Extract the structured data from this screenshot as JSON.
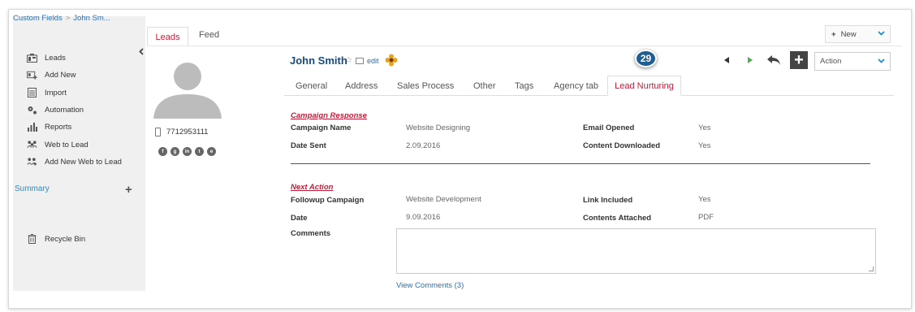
{
  "breadcrumb": {
    "items": [
      "Custom Fields",
      "John Sm..."
    ],
    "separator": ">"
  },
  "sidebar": {
    "items": [
      {
        "label": "Leads",
        "icon": "leads-icon"
      },
      {
        "label": "Add New",
        "icon": "add-new-icon"
      },
      {
        "label": "Import",
        "icon": "import-icon"
      },
      {
        "label": "Automation",
        "icon": "automation-icon"
      },
      {
        "label": "Reports",
        "icon": "reports-icon"
      },
      {
        "label": "Web to Lead",
        "icon": "web-to-lead-icon"
      },
      {
        "label": "Add New Web to Lead",
        "icon": "add-web-to-lead-icon"
      }
    ],
    "summary_label": "Summary",
    "recycle_label": "Recycle Bin"
  },
  "top_tabs": {
    "leads": "Leads",
    "feed": "Feed"
  },
  "new_button": {
    "plus": "+",
    "label": "New"
  },
  "profile": {
    "phone": "7712953111",
    "social_icons": [
      "f",
      "g",
      "in",
      "t",
      "e"
    ]
  },
  "header": {
    "name": "John Smith",
    "star": "☆",
    "edit_label": "edit",
    "badge": "29",
    "action_select": "Action",
    "add_symbol": "+"
  },
  "tabs": [
    "General",
    "Address",
    "Sales Process",
    "Other",
    "Tags",
    "Agency tab"
  ],
  "active_tab": "Lead Nurturing",
  "campaign_response": {
    "title": "Campaign Response",
    "campaign_name_label": "Campaign Name",
    "campaign_name": "Website Designing",
    "date_sent_label": "Date Sent",
    "date_sent": "2.09.2016",
    "email_opened_label": "Email Opened",
    "email_opened": "Yes",
    "content_downloaded_label": "Content Downloaded",
    "content_downloaded": "Yes"
  },
  "next_action": {
    "title": "Next Action",
    "followup_label": "Followup Campaign",
    "followup": "Website Development",
    "date_label": "Date",
    "date": "9.09.2016",
    "link_included_label": "Link Included",
    "link_included": "Yes",
    "contents_attached_label": "Contents Attached",
    "contents_attached": "PDF",
    "comments_label": "Comments",
    "comments_value": "",
    "view_comments": "View Comments (3)"
  },
  "colors": {
    "accent_red": "#c0203a",
    "link_blue": "#2a6fb0",
    "name_blue": "#1b4a7a",
    "badge_blue": "#1f5d93"
  }
}
